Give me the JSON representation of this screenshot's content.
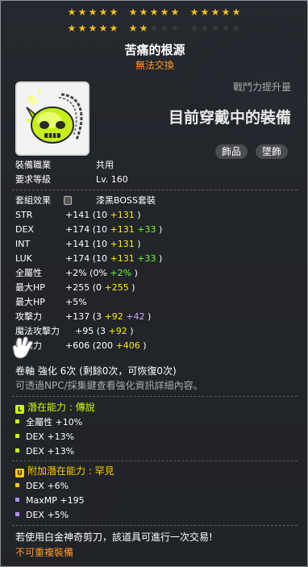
{
  "header": {
    "stars_row1": {
      "filled": 15,
      "total": 15
    },
    "stars_row2": {
      "filled": 7,
      "total": 15
    },
    "item_name": "苦痛的根源",
    "trade_status": "無法交換"
  },
  "summary": {
    "power_up": "戰鬥力提升量",
    "equipped": "目前穿戴中的裝備",
    "categories": [
      "飾品",
      "墜飾"
    ]
  },
  "requirements": [
    {
      "label": "裝備職業",
      "value": "共用"
    },
    {
      "label": "要求等級",
      "value": "Lv. 160"
    }
  ],
  "set_effect": {
    "label": "套組效果",
    "value": "漆黑BOSS套裝"
  },
  "stats": [
    {
      "name": "STR",
      "total": "+141",
      "base": "(10",
      "plus": "+131",
      "extra": "",
      "close": ")"
    },
    {
      "name": "DEX",
      "total": "+174",
      "base": "(10",
      "plus": "+131",
      "extra": "+33",
      "close": ")"
    },
    {
      "name": "INT",
      "total": "+141",
      "base": "(10",
      "plus": "+131",
      "extra": "",
      "close": ")"
    },
    {
      "name": "LUK",
      "total": "+174",
      "base": "(10",
      "plus": "+131",
      "extra": "+33",
      "close": ")"
    },
    {
      "name": "全屬性",
      "total": "+2%",
      "base": "(0%",
      "plus": "",
      "extra": "+2%",
      "close": ")"
    },
    {
      "name": "最大HP",
      "total": "+255",
      "base": "(0",
      "plus": "+255",
      "extra": "",
      "close": ")"
    },
    {
      "name": "最大HP",
      "total": "+5%",
      "base": "",
      "plus": "",
      "extra": "",
      "close": ""
    },
    {
      "name": "攻擊力",
      "total": "+137",
      "base": "(3",
      "plus": "+92",
      "extra": "+42",
      "close": ")"
    },
    {
      "name": "魔法攻擊力",
      "total": "+95",
      "base": "(3",
      "plus": "+92",
      "extra": "",
      "close": ")"
    },
    {
      "name": "防禦力",
      "total": "+606",
      "base": "(200",
      "plus": "+406",
      "extra": "",
      "close": ")"
    }
  ],
  "scroll_line": "卷軸 強化 6次 (剩餘0次，可恢復0次)",
  "npc_note": "可透過NPC/採集鍵查看強化資訊詳細內容。",
  "potential": {
    "icon": "L",
    "title": "潛在能力 : 傳說",
    "lines": [
      "全屬性 +10%",
      "DEX +13%",
      "DEX +13%"
    ]
  },
  "additional_potential": {
    "icon": "U",
    "title": "附加潛在能力 : 罕見",
    "lines": [
      {
        "text": "DEX +6%",
        "color": "#ffcc00"
      },
      {
        "text": "MaxMP +195",
        "color": "#b18cff"
      },
      {
        "text": "DEX +5%",
        "color": "#b18cff"
      }
    ]
  },
  "footer": {
    "scissors_note": "若使用白金神奇剪刀，該道具可進行一次交易!",
    "no_duplicate": "不可重複裝備"
  },
  "colors": {
    "star_on": "#f4c21a",
    "trade_orange": "#ff9a29",
    "legend_green": "#ccff00",
    "unique_gold": "#ffcc00"
  }
}
